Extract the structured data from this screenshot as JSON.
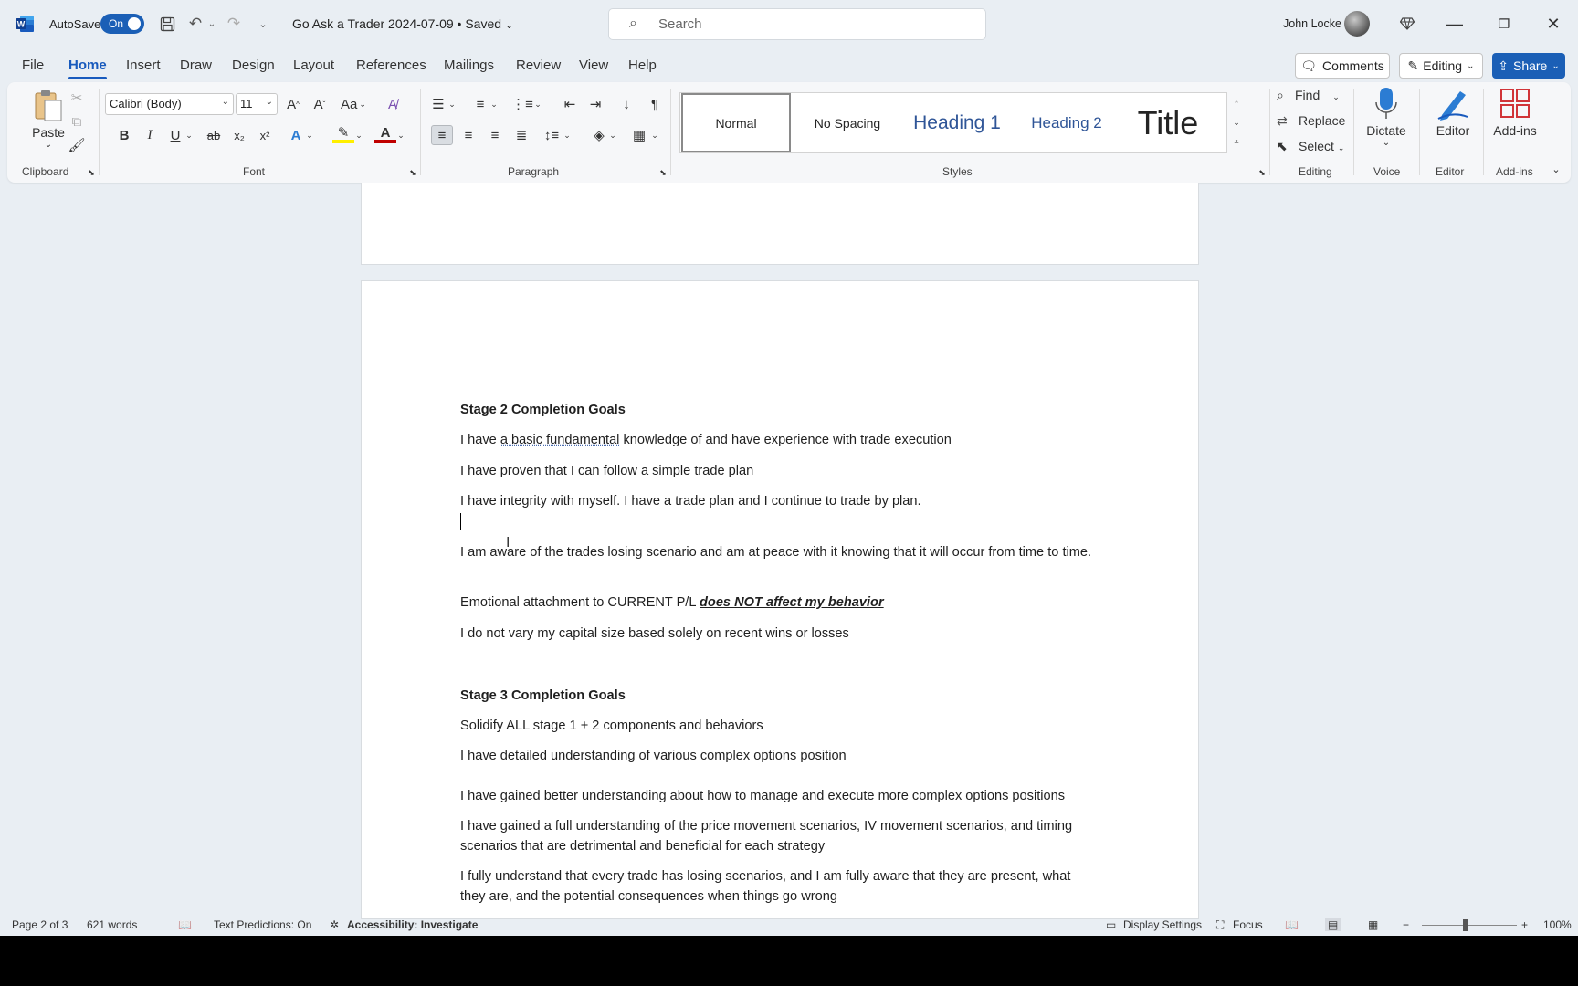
{
  "titlebar": {
    "autosave_label": "AutoSave",
    "autosave_state": "On",
    "doc_title": "Go Ask a Trader 2024-07-09 • Saved",
    "search_placeholder": "Search",
    "user_name": "John Locke"
  },
  "menu": {
    "tabs": [
      "File",
      "Home",
      "Insert",
      "Draw",
      "Design",
      "Layout",
      "References",
      "Mailings",
      "Review",
      "View",
      "Help"
    ],
    "active": "Home",
    "comments_label": "Comments",
    "editing_label": "Editing",
    "share_label": "Share"
  },
  "ribbon": {
    "clipboard": {
      "paste_label": "Paste",
      "group_label": "Clipboard"
    },
    "font": {
      "font_name": "Calibri (Body)",
      "font_size": "11",
      "change_case": "Aa",
      "group_label": "Font"
    },
    "paragraph": {
      "group_label": "Paragraph"
    },
    "styles": {
      "items": [
        "Normal",
        "No Spacing",
        "Heading 1",
        "Heading 2",
        "Title"
      ],
      "selected": "Normal",
      "group_label": "Styles"
    },
    "editing": {
      "find_label": "Find",
      "replace_label": "Replace",
      "select_label": "Select",
      "group_label": "Editing"
    },
    "voice": {
      "dictate_label": "Dictate",
      "group_label": "Voice"
    },
    "editor": {
      "editor_label": "Editor",
      "group_label": "Editor"
    },
    "addins": {
      "addins_label": "Add-ins",
      "group_label": "Add-ins"
    }
  },
  "document": {
    "stage2_heading": "Stage 2 Completion Goals",
    "stage2_line1_pre": "I have ",
    "stage2_line1_flag": "a basic fundamental",
    "stage2_line1_post": " knowledge of and have experience with trade execution",
    "stage2_line2": "I have proven that I can follow a simple trade plan",
    "stage2_line3": "I have integrity with myself. I have a trade plan and I continue to trade by plan.",
    "stage2_line4": "I am aware of the trades losing scenario and am at peace with it knowing that it will occur from time to time.",
    "stage2_line5_pre": "Emotional attachment to CURRENT P/L ",
    "stage2_line5_emph": "does NOT affect my behavior",
    "stage2_line6": "I do not vary my capital size based solely on recent wins or losses",
    "stage3_heading": "Stage 3 Completion Goals",
    "stage3_line1": "Solidify ALL stage 1 + 2 components and behaviors",
    "stage3_line2": "I have detailed understanding of various complex options position",
    "stage3_line3": "I have gained better understanding about how to manage and execute more complex options positions",
    "stage3_line4": "I have gained a full understanding of the price movement scenarios, IV movement scenarios, and timing scenarios that are detrimental and beneficial for each strategy",
    "stage3_line5": "I fully understand that every trade has losing scenarios, and I am fully aware that they are present, what they are, and the potential consequences when things go wrong"
  },
  "status": {
    "page": "Page 2 of 3",
    "words": "621 words",
    "text_predictions": "Text Predictions: On",
    "accessibility": "Accessibility: Investigate",
    "display_settings": "Display Settings",
    "focus": "Focus",
    "zoom": "100%"
  },
  "colors": {
    "accent": "#185abd",
    "share_bg": "#1b5fb6",
    "background": "#e9eef3"
  }
}
